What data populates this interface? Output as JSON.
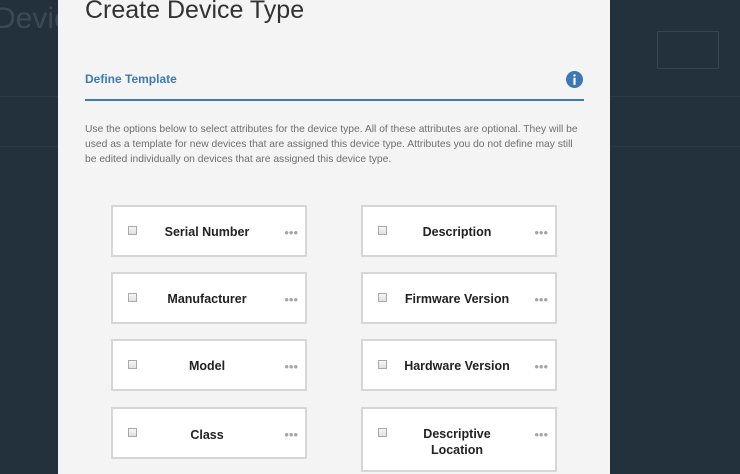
{
  "background": {
    "title_fragment": "Devic",
    "subtitle_fragment": "",
    "button_label": ""
  },
  "modal": {
    "title": "Create Device Type",
    "section_title": "Define Template",
    "description": "Use the options below to select attributes for the device type. All of these attributes are optional. They will be used as a template for new devices that are assigned this device type. Attributes you do not define may still be edited individually on devices that are assigned this device type.",
    "attributes": [
      {
        "label": "Serial Number",
        "checked": false
      },
      {
        "label": "Description",
        "checked": false
      },
      {
        "label": "Manufacturer",
        "checked": false
      },
      {
        "label": "Firmware Version",
        "checked": false
      },
      {
        "label": "Model",
        "checked": false
      },
      {
        "label": "Hardware Version",
        "checked": false
      },
      {
        "label": "Class",
        "checked": false
      },
      {
        "label": "Descriptive Location",
        "checked": false
      }
    ],
    "more_glyph": "•••"
  },
  "colors": {
    "accent": "#3d7ab8",
    "backdrop": "#23313c",
    "info_icon": "#3b78b5"
  },
  "icons": {
    "info": "info-icon",
    "more": "more-options-icon",
    "checkbox": "checkbox"
  }
}
